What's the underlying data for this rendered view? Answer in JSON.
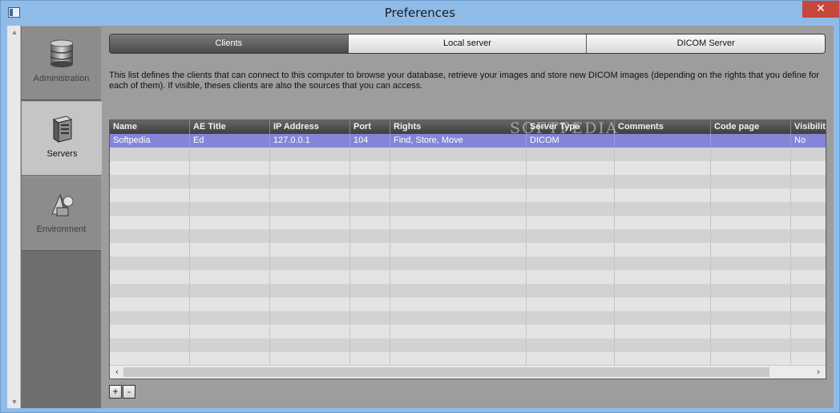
{
  "window": {
    "title": "Preferences",
    "close_glyph": "✕"
  },
  "nav": {
    "items": [
      {
        "label": "Administration",
        "icon": "database-icon"
      },
      {
        "label": "Servers",
        "icon": "server-icon"
      },
      {
        "label": "Environment",
        "icon": "shapes-icon"
      }
    ],
    "active": "Servers"
  },
  "tabs": [
    {
      "label": "Clients"
    },
    {
      "label": "Local server"
    },
    {
      "label": "DICOM Server"
    }
  ],
  "active_tab": "Clients",
  "description": "This list defines the clients that can connect to this computer to browse your database, retrieve your images and store new DICOM images (depending on the rights that you define for each of them).  If visible, theses clients are also the sources that you can access.",
  "table": {
    "columns": [
      "Name",
      "AE Title",
      "IP Address",
      "Port",
      "Rights",
      "Server Type",
      "Comments",
      "Code page",
      "Visibility"
    ],
    "rows": [
      [
        "Softpedia",
        "Ed",
        "127.0.0.1",
        "104",
        "Find, Store, Move",
        "DICOM",
        "",
        "",
        "No"
      ]
    ]
  },
  "buttons": {
    "add": "+",
    "remove": "-"
  },
  "watermark": "SOFTPEDIA",
  "colors": {
    "selected_row": "#8585d8",
    "active_tab": "#555555",
    "close_button": "#c7473d"
  }
}
